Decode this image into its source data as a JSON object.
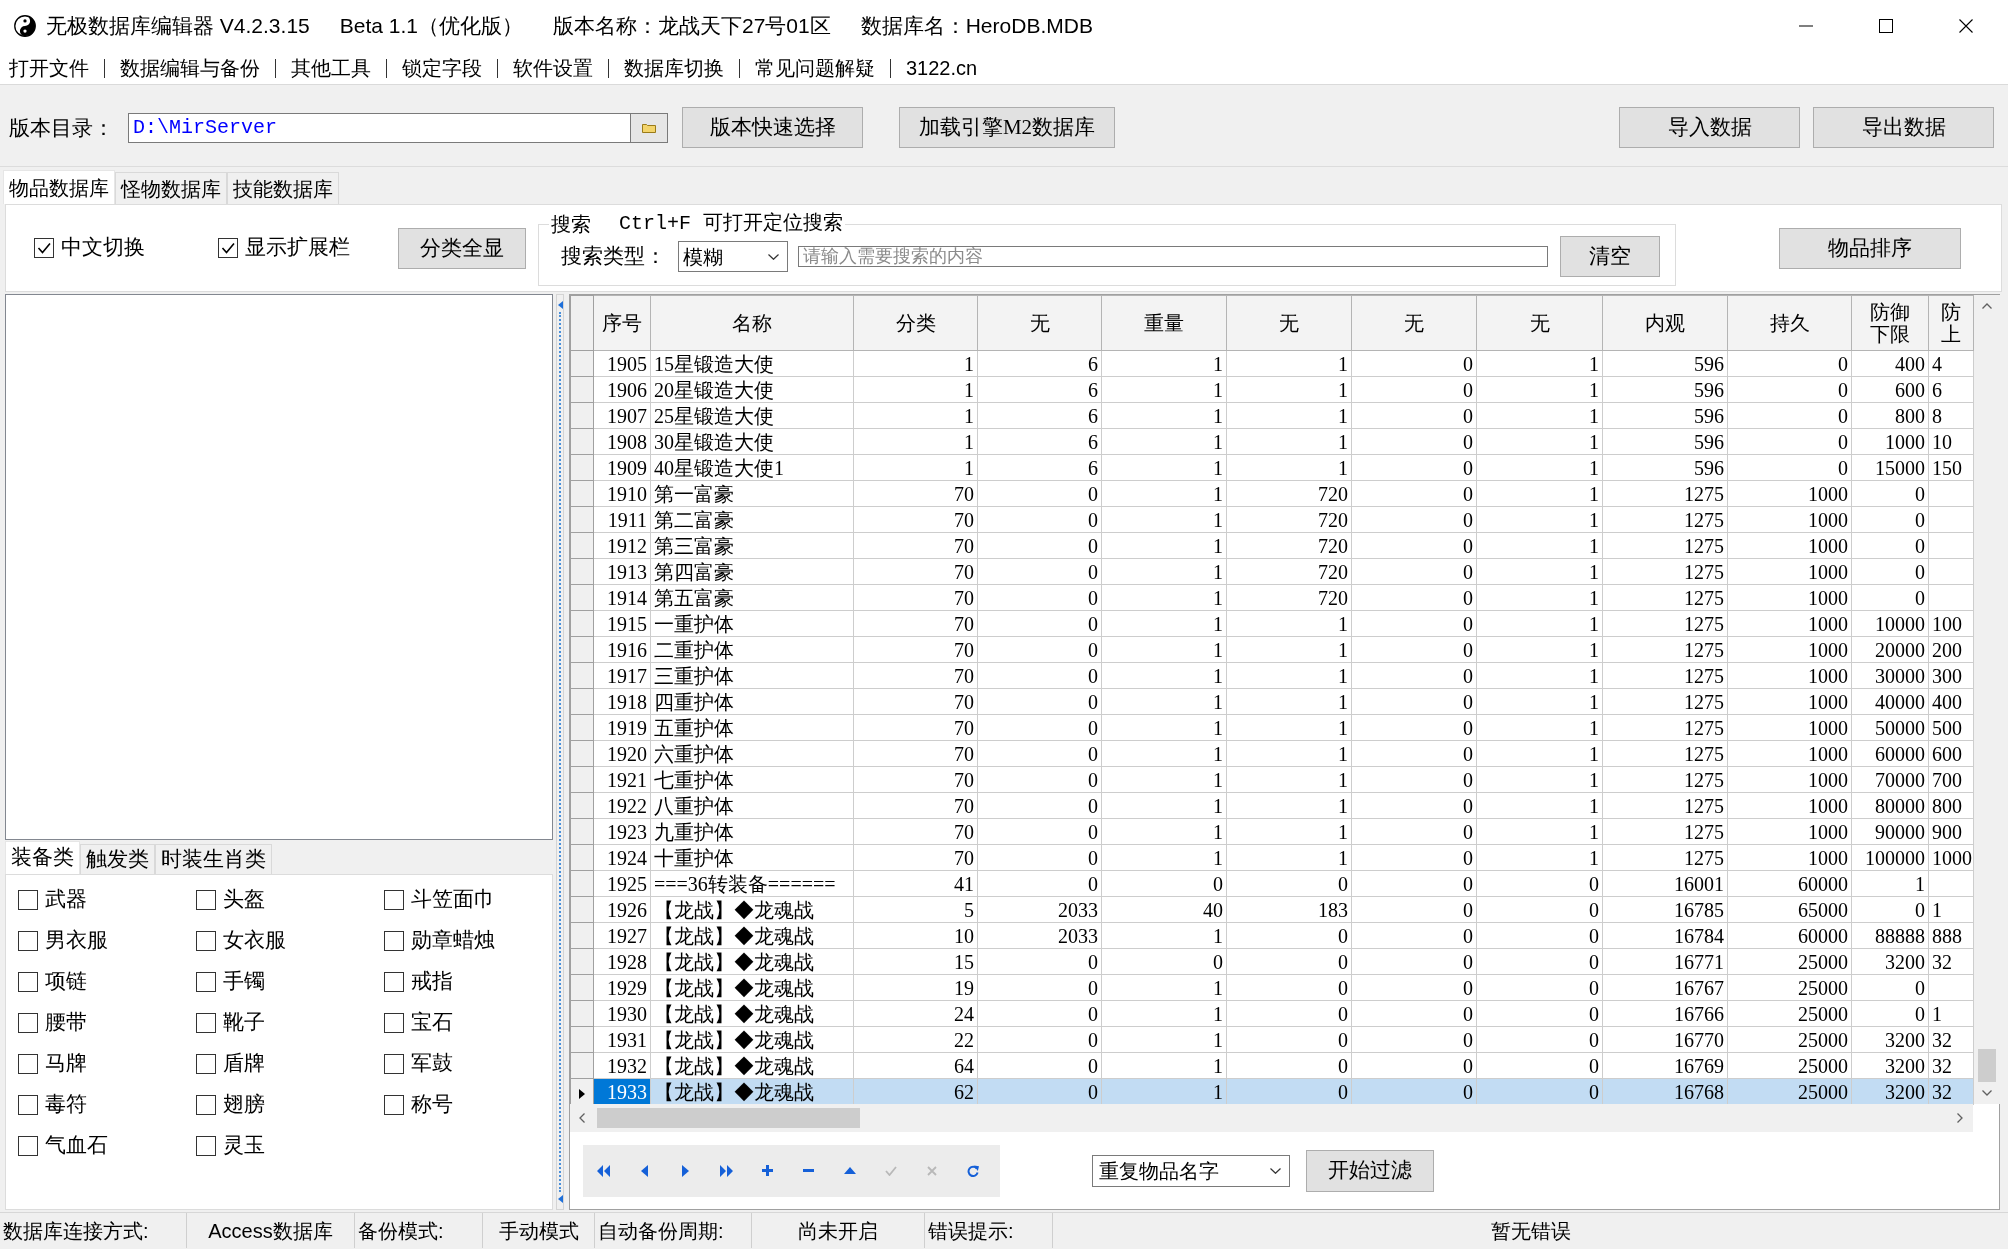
{
  "window": {
    "title": [
      "无极数据库编辑器 V4.2.3.15",
      "Beta 1.1（优化版）",
      "版本名称：龙战天下27号01区",
      "数据库名：HeroDB.MDB"
    ]
  },
  "menu": [
    "打开文件",
    "数据编辑与备份",
    "其他工具",
    "锁定字段",
    "软件设置",
    "数据库切换",
    "常见问题解疑",
    "3122.cn"
  ],
  "toolbar": {
    "path_label": "版本目录：",
    "path_value": "D:\\MirServer",
    "buttons": [
      "版本快速选择",
      "加载引擎M2数据库"
    ],
    "data_buttons": [
      "导入数据",
      "导出数据"
    ]
  },
  "tabs": [
    {
      "label": "物品数据库",
      "selected": true
    },
    {
      "label": "怪物数据库",
      "selected": false
    },
    {
      "label": "技能数据库",
      "selected": false
    }
  ],
  "options": {
    "checkboxes": [
      {
        "label": "中文切换",
        "checked": true
      },
      {
        "label": "显示扩展栏",
        "checked": true
      }
    ],
    "show_all_button": "分类全显"
  },
  "search": {
    "title": "搜索",
    "hint": "Ctrl+F 可打开定位搜索",
    "type_label": "搜索类型：",
    "type_value": "模糊",
    "placeholder": "请输入需要搜索的内容",
    "clear_button": "清空"
  },
  "sort_button": "物品排序",
  "category_tabs": [
    {
      "label": "装备类",
      "selected": true
    },
    {
      "label": "触发类",
      "selected": false
    },
    {
      "label": "时装生肖类",
      "selected": false
    }
  ],
  "categories": [
    {
      "label": "武器",
      "checked": false
    },
    {
      "label": "头盔",
      "checked": false
    },
    {
      "label": "斗笠面巾",
      "checked": false
    },
    {
      "label": "男衣服",
      "checked": false
    },
    {
      "label": "女衣服",
      "checked": false
    },
    {
      "label": "勋章蜡烛",
      "checked": false
    },
    {
      "label": "项链",
      "checked": false
    },
    {
      "label": "手镯",
      "checked": false
    },
    {
      "label": "戒指",
      "checked": false
    },
    {
      "label": "腰带",
      "checked": false
    },
    {
      "label": "靴子",
      "checked": false
    },
    {
      "label": "宝石",
      "checked": false
    },
    {
      "label": "马牌",
      "checked": false
    },
    {
      "label": "盾牌",
      "checked": false
    },
    {
      "label": "军鼓",
      "checked": false
    },
    {
      "label": "毒符",
      "checked": false
    },
    {
      "label": "翅膀",
      "checked": false
    },
    {
      "label": "称号",
      "checked": false
    },
    {
      "label": "气血石",
      "checked": false
    },
    {
      "label": "灵玉",
      "checked": false
    }
  ],
  "table": {
    "columns": [
      "序号",
      "名称",
      "分类",
      "无",
      "重量",
      "无",
      "无",
      "无",
      "内观",
      "持久",
      "防御下限",
      "防上"
    ],
    "rows": [
      {
        "cells": [
          "1905",
          "15星锻造大使",
          "1",
          "6",
          "1",
          "1",
          "0",
          "1",
          "596",
          "0",
          "400",
          "4"
        ],
        "selected": false
      },
      {
        "cells": [
          "1906",
          "20星锻造大使",
          "1",
          "6",
          "1",
          "1",
          "0",
          "1",
          "596",
          "0",
          "600",
          "6"
        ],
        "selected": false
      },
      {
        "cells": [
          "1907",
          "25星锻造大使",
          "1",
          "6",
          "1",
          "1",
          "0",
          "1",
          "596",
          "0",
          "800",
          "8"
        ],
        "selected": false
      },
      {
        "cells": [
          "1908",
          "30星锻造大使",
          "1",
          "6",
          "1",
          "1",
          "0",
          "1",
          "596",
          "0",
          "1000",
          "10"
        ],
        "selected": false
      },
      {
        "cells": [
          "1909",
          "40星锻造大使1",
          "1",
          "6",
          "1",
          "1",
          "0",
          "1",
          "596",
          "0",
          "15000",
          "150"
        ],
        "selected": false
      },
      {
        "cells": [
          "1910",
          "第一富豪",
          "70",
          "0",
          "1",
          "720",
          "0",
          "1",
          "1275",
          "1000",
          "0"
        ],
        "selected": false
      },
      {
        "cells": [
          "1911",
          "第二富豪",
          "70",
          "0",
          "1",
          "720",
          "0",
          "1",
          "1275",
          "1000",
          "0"
        ],
        "selected": false
      },
      {
        "cells": [
          "1912",
          "第三富豪",
          "70",
          "0",
          "1",
          "720",
          "0",
          "1",
          "1275",
          "1000",
          "0"
        ],
        "selected": false
      },
      {
        "cells": [
          "1913",
          "第四富豪",
          "70",
          "0",
          "1",
          "720",
          "0",
          "1",
          "1275",
          "1000",
          "0"
        ],
        "selected": false
      },
      {
        "cells": [
          "1914",
          "第五富豪",
          "70",
          "0",
          "1",
          "720",
          "0",
          "1",
          "1275",
          "1000",
          "0"
        ],
        "selected": false
      },
      {
        "cells": [
          "1915",
          "一重护体",
          "70",
          "0",
          "1",
          "1",
          "0",
          "1",
          "1275",
          "1000",
          "10000",
          "100"
        ],
        "selected": false
      },
      {
        "cells": [
          "1916",
          "二重护体",
          "70",
          "0",
          "1",
          "1",
          "0",
          "1",
          "1275",
          "1000",
          "20000",
          "200"
        ],
        "selected": false
      },
      {
        "cells": [
          "1917",
          "三重护体",
          "70",
          "0",
          "1",
          "1",
          "0",
          "1",
          "1275",
          "1000",
          "30000",
          "300"
        ],
        "selected": false
      },
      {
        "cells": [
          "1918",
          "四重护体",
          "70",
          "0",
          "1",
          "1",
          "0",
          "1",
          "1275",
          "1000",
          "40000",
          "400"
        ],
        "selected": false
      },
      {
        "cells": [
          "1919",
          "五重护体",
          "70",
          "0",
          "1",
          "1",
          "0",
          "1",
          "1275",
          "1000",
          "50000",
          "500"
        ],
        "selected": false
      },
      {
        "cells": [
          "1920",
          "六重护体",
          "70",
          "0",
          "1",
          "1",
          "0",
          "1",
          "1275",
          "1000",
          "60000",
          "600"
        ],
        "selected": false
      },
      {
        "cells": [
          "1921",
          "七重护体",
          "70",
          "0",
          "1",
          "1",
          "0",
          "1",
          "1275",
          "1000",
          "70000",
          "700"
        ],
        "selected": false
      },
      {
        "cells": [
          "1922",
          "八重护体",
          "70",
          "0",
          "1",
          "1",
          "0",
          "1",
          "1275",
          "1000",
          "80000",
          "800"
        ],
        "selected": false
      },
      {
        "cells": [
          "1923",
          "九重护体",
          "70",
          "0",
          "1",
          "1",
          "0",
          "1",
          "1275",
          "1000",
          "90000",
          "900"
        ],
        "selected": false
      },
      {
        "cells": [
          "1924",
          "十重护体",
          "70",
          "0",
          "1",
          "1",
          "0",
          "1",
          "1275",
          "1000",
          "100000",
          "1000"
        ],
        "selected": false
      },
      {
        "cells": [
          "1925",
          "===36转装备======",
          "41",
          "0",
          "0",
          "0",
          "0",
          "0",
          "16001",
          "60000",
          "1"
        ],
        "selected": false
      },
      {
        "cells": [
          "1926",
          "【龙战】◆龙魂战",
          "5",
          "2033",
          "40",
          "183",
          "0",
          "0",
          "16785",
          "65000",
          "0",
          "1"
        ],
        "selected": false
      },
      {
        "cells": [
          "1927",
          "【龙战】◆龙魂战",
          "10",
          "2033",
          "1",
          "0",
          "0",
          "0",
          "16784",
          "60000",
          "88888",
          "888"
        ],
        "selected": false
      },
      {
        "cells": [
          "1928",
          "【龙战】◆龙魂战",
          "15",
          "0",
          "0",
          "0",
          "0",
          "0",
          "16771",
          "25000",
          "3200",
          "32"
        ],
        "selected": false
      },
      {
        "cells": [
          "1929",
          "【龙战】◆龙魂战",
          "19",
          "0",
          "1",
          "0",
          "0",
          "0",
          "16767",
          "25000",
          "0"
        ],
        "selected": false
      },
      {
        "cells": [
          "1930",
          "【龙战】◆龙魂战",
          "24",
          "0",
          "1",
          "0",
          "0",
          "0",
          "16766",
          "25000",
          "0",
          "1"
        ],
        "selected": false
      },
      {
        "cells": [
          "1931",
          "【龙战】◆龙魂战",
          "22",
          "0",
          "1",
          "0",
          "0",
          "0",
          "16770",
          "25000",
          "3200",
          "32"
        ],
        "selected": false
      },
      {
        "cells": [
          "1932",
          "【龙战】◆龙魂战",
          "64",
          "0",
          "1",
          "0",
          "0",
          "0",
          "16769",
          "25000",
          "3200",
          "32"
        ],
        "selected": false
      },
      {
        "cells": [
          "1933",
          "【龙战】◆龙魂战",
          "62",
          "0",
          "1",
          "0",
          "0",
          "0",
          "16768",
          "25000",
          "3200",
          "32"
        ],
        "selected": true
      }
    ]
  },
  "navigator": [
    {
      "kind": "first",
      "disabled": false
    },
    {
      "kind": "prior",
      "disabled": false
    },
    {
      "kind": "next",
      "disabled": false
    },
    {
      "kind": "last",
      "disabled": false
    },
    {
      "kind": "insert",
      "disabled": false
    },
    {
      "kind": "delete",
      "disabled": false
    },
    {
      "kind": "edit",
      "disabled": false
    },
    {
      "kind": "post",
      "disabled": true
    },
    {
      "kind": "cancel",
      "disabled": true
    },
    {
      "kind": "refresh",
      "disabled": false
    }
  ],
  "filter": {
    "value": "重复物品名字",
    "button": "开始过滤"
  },
  "status_bar": [
    {
      "kind": "label",
      "text": "数据库连接方式:"
    },
    {
      "kind": "value",
      "text": "Access数据库"
    },
    {
      "kind": "label",
      "text": "备份模式:"
    },
    {
      "kind": "value",
      "text": "手动模式"
    },
    {
      "kind": "label",
      "text": "自动备份周期:"
    },
    {
      "kind": "value",
      "text": "尚未开启"
    },
    {
      "kind": "label",
      "text": "错误提示:"
    },
    {
      "kind": "value",
      "text": "暂无错误"
    }
  ]
}
